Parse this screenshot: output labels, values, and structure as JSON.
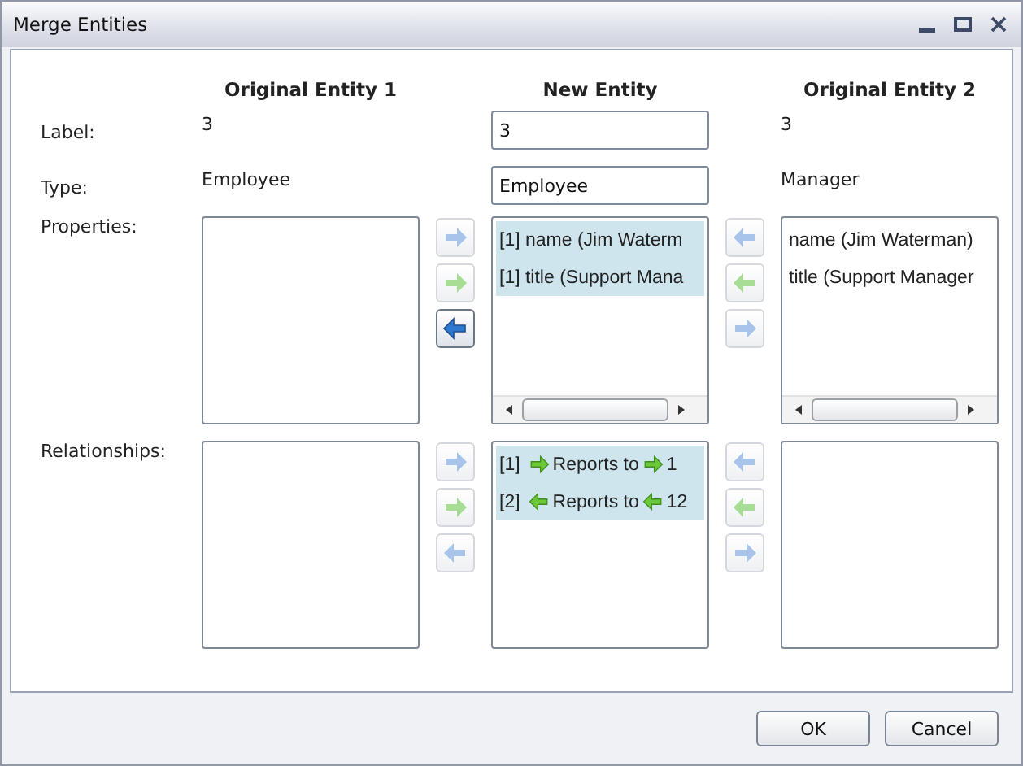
{
  "window": {
    "title": "Merge Entities"
  },
  "headings": [
    "Original Entity 1",
    "New Entity",
    "Original Entity 2"
  ],
  "fields": [
    {
      "label": "Label:",
      "original_1": "3",
      "new": "3",
      "original_2": "3"
    },
    {
      "label": "Type:",
      "original_1": "Employee",
      "new": "Employee",
      "original_2": "Manager"
    }
  ],
  "sections": [
    {
      "kind": "properties",
      "label": "Properties:",
      "original_1": {
        "horizontal_scrollbar": false
      },
      "left_arrows": [
        {
          "kind": "right",
          "color": "#a9c4ea",
          "disabled": true
        },
        {
          "kind": "right",
          "color": "#a8dd95",
          "disabled": true
        },
        {
          "kind": "left",
          "color": "#2f78d0",
          "disabled": false
        }
      ],
      "new": {
        "horizontal_scrollbar": true,
        "items": [
          {
            "text": "[1] name (Jim Waterm",
            "selected": true
          },
          {
            "text": "[1] title (Support Mana",
            "selected": true
          }
        ]
      },
      "right_arrows": [
        {
          "kind": "left",
          "color": "#a9c4ea",
          "disabled": true
        },
        {
          "kind": "left",
          "color": "#a8dd95",
          "disabled": true
        },
        {
          "kind": "right",
          "color": "#a9c4ea",
          "disabled": true
        }
      ],
      "original_2": {
        "horizontal_scrollbar": true,
        "items": [
          {
            "text": "name (Jim Waterman)",
            "selected": false
          },
          {
            "text": "title (Support Manager",
            "selected": false
          }
        ]
      }
    },
    {
      "kind": "relationships",
      "label": "Relationships:",
      "original_1": {
        "horizontal_scrollbar": false
      },
      "left_arrows": [
        {
          "kind": "right",
          "color": "#a9c4ea",
          "disabled": true
        },
        {
          "kind": "right",
          "color": "#a8dd95",
          "disabled": true
        },
        {
          "kind": "left",
          "color": "#a9c4ea",
          "disabled": true
        }
      ],
      "new": {
        "horizontal_scrollbar": false,
        "items": [
          {
            "index": "[1]",
            "kind": "right",
            "relation": "Reports to",
            "target": "1",
            "selected": true
          },
          {
            "index": "[2]",
            "kind": "left",
            "relation": "Reports to",
            "target": "12",
            "selected": true
          }
        ]
      },
      "right_arrows": [
        {
          "kind": "left",
          "color": "#a9c4ea",
          "disabled": true
        },
        {
          "kind": "left",
          "color": "#a8dd95",
          "disabled": true
        },
        {
          "kind": "right",
          "color": "#a9c4ea",
          "disabled": true
        }
      ],
      "original_2": {
        "horizontal_scrollbar": false
      }
    }
  ],
  "buttons": [
    "OK",
    "Cancel"
  ]
}
